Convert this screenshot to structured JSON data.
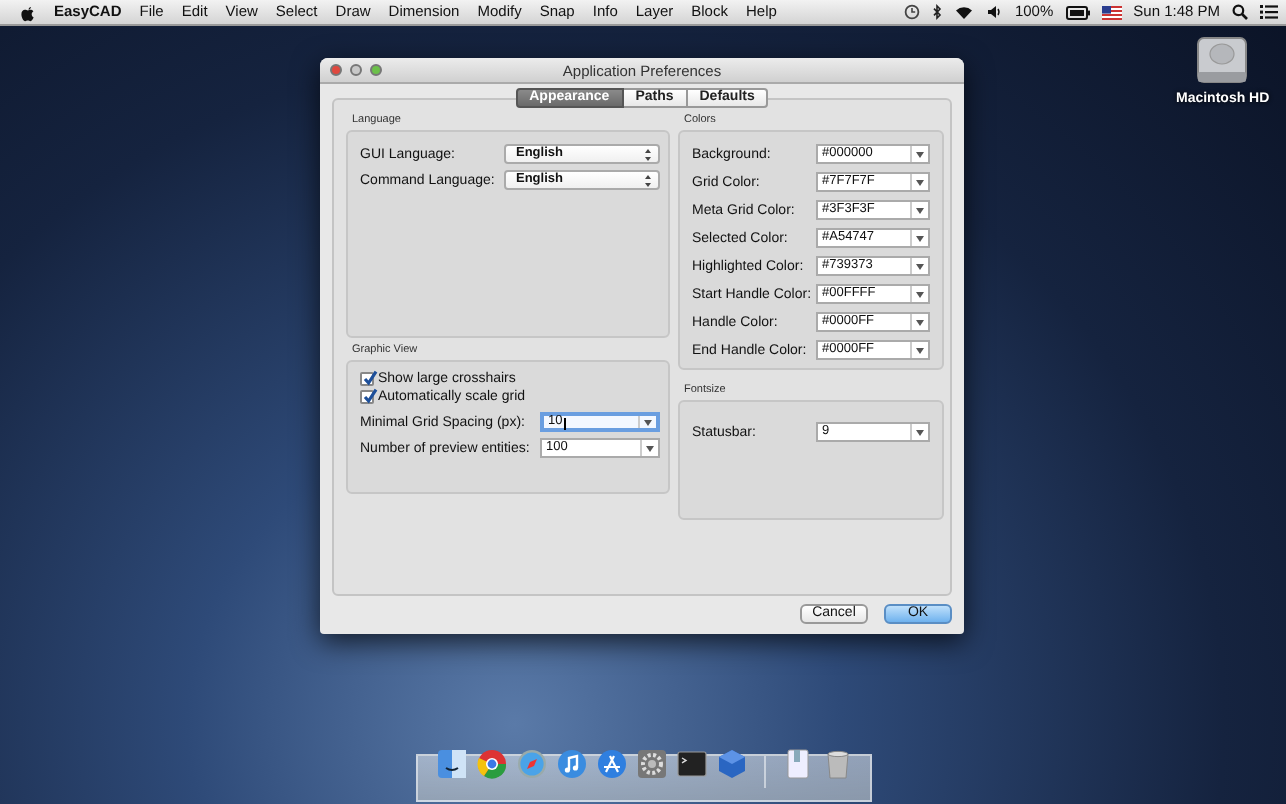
{
  "menu_bar": {
    "app_name": "EasyCAD",
    "menus": [
      "File",
      "Edit",
      "View",
      "Select",
      "Draw",
      "Dimension",
      "Modify",
      "Snap",
      "Info",
      "Layer",
      "Block",
      "Help"
    ],
    "battery": "100%",
    "clock": "Sun 1:48 PM"
  },
  "desktop_icons": [
    {
      "label": "Macintosh HD"
    }
  ],
  "window": {
    "title": "Application Preferences",
    "tabs": [
      {
        "label": "Appearance",
        "selected": true
      },
      {
        "label": "Paths",
        "selected": false
      },
      {
        "label": "Defaults",
        "selected": false
      }
    ],
    "language": {
      "title": "Language",
      "fields": [
        {
          "label": "GUI Language:",
          "value": "English"
        },
        {
          "label": "Command Language:",
          "value": "English"
        }
      ]
    },
    "graphic_view": {
      "title": "Graphic View",
      "checkboxes": [
        {
          "label": "Show large crosshairs",
          "checked": true
        },
        {
          "label": "Automatically scale grid",
          "checked": true
        }
      ],
      "fields": [
        {
          "label": "Minimal Grid Spacing (px):",
          "value": "10",
          "focused": true
        },
        {
          "label": "Number of preview entities:",
          "value": "100",
          "focused": false
        }
      ]
    },
    "colors": {
      "title": "Colors",
      "fields": [
        {
          "label": "Background:",
          "value": "#000000"
        },
        {
          "label": "Grid Color:",
          "value": "#7F7F7F"
        },
        {
          "label": "Meta Grid Color:",
          "value": "#3F3F3F"
        },
        {
          "label": "Selected Color:",
          "value": "#A54747"
        },
        {
          "label": "Highlighted Color:",
          "value": "#739373"
        },
        {
          "label": "Start Handle Color:",
          "value": "#00FFFF"
        },
        {
          "label": "Handle Color:",
          "value": "#0000FF"
        },
        {
          "label": "End Handle Color:",
          "value": "#0000FF"
        }
      ]
    },
    "fontsize": {
      "title": "Fontsize",
      "fields": [
        {
          "label": "Statusbar:",
          "value": "9"
        }
      ]
    },
    "buttons": [
      {
        "label": "Cancel",
        "default": false
      },
      {
        "label": "OK",
        "default": true
      }
    ]
  }
}
